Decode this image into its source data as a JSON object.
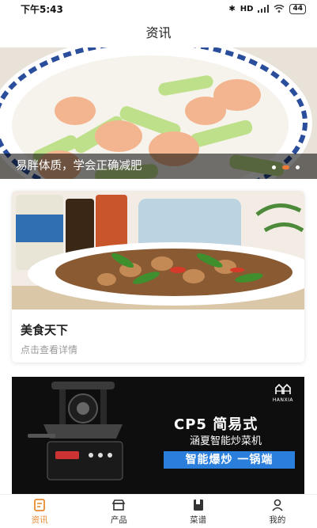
{
  "status_bar": {
    "time": "下午5:43",
    "network": "HD",
    "battery": "44"
  },
  "header": {
    "title": "资讯"
  },
  "banner": {
    "caption": "易胖体质，学会正确减肥",
    "slides": 3,
    "active_slide": 2
  },
  "card": {
    "title": "美食天下",
    "subtitle": "点击查看详情"
  },
  "ad": {
    "brand": "HANXIA",
    "headline": "CP5 简易式",
    "subhead": "涵夏智能炒菜机",
    "pill": "智能爆炒 一锅端"
  },
  "tabs": [
    {
      "label": "资讯",
      "icon": "news-icon",
      "active": true
    },
    {
      "label": "产品",
      "icon": "store-icon",
      "active": false
    },
    {
      "label": "菜谱",
      "icon": "book-icon",
      "active": false
    },
    {
      "label": "我的",
      "icon": "profile-icon",
      "active": false
    }
  ],
  "colors": {
    "accent": "#e88a2e",
    "ad_background": "#0e0e0e",
    "ad_pill": "#2a7fdc"
  }
}
